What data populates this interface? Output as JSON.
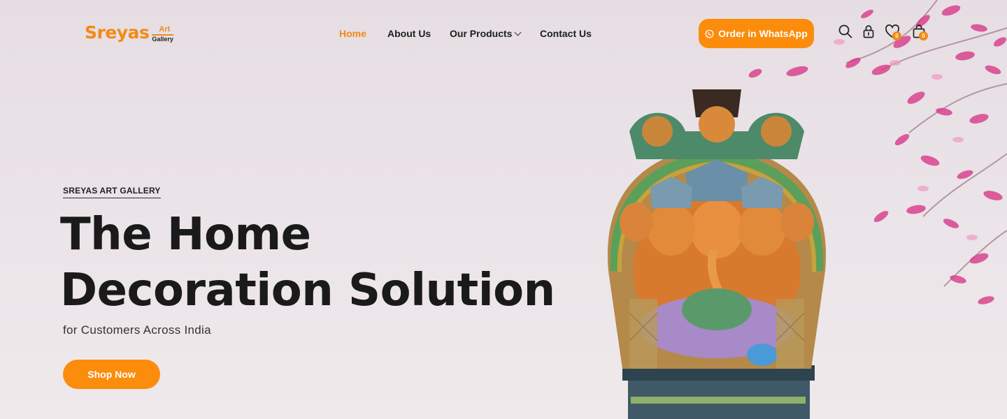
{
  "logo": {
    "main": "Sreyas",
    "art": "Art",
    "gallery": "Gallery"
  },
  "nav": {
    "items": [
      {
        "label": "Home",
        "active": true
      },
      {
        "label": "About Us"
      },
      {
        "label": "Our Products",
        "has_dropdown": true
      },
      {
        "label": "Contact Us"
      }
    ]
  },
  "header": {
    "whatsapp_label": "Order in WhatsApp",
    "wishlist_count": "0",
    "cart_count": "0",
    "icons": [
      "search-icon",
      "lock-icon",
      "heart-icon",
      "bag-icon"
    ]
  },
  "hero": {
    "kicker": "SREYAS ART GALLERY",
    "title_line1": "The Home",
    "title_line2": "Decoration Solution",
    "subtitle": "for Customers Across India",
    "cta": "Shop Now"
  },
  "colors": {
    "accent": "#f28a17",
    "button": "#fb8c0c",
    "text": "#1a1a1a",
    "blossom": "#d93a8a"
  }
}
